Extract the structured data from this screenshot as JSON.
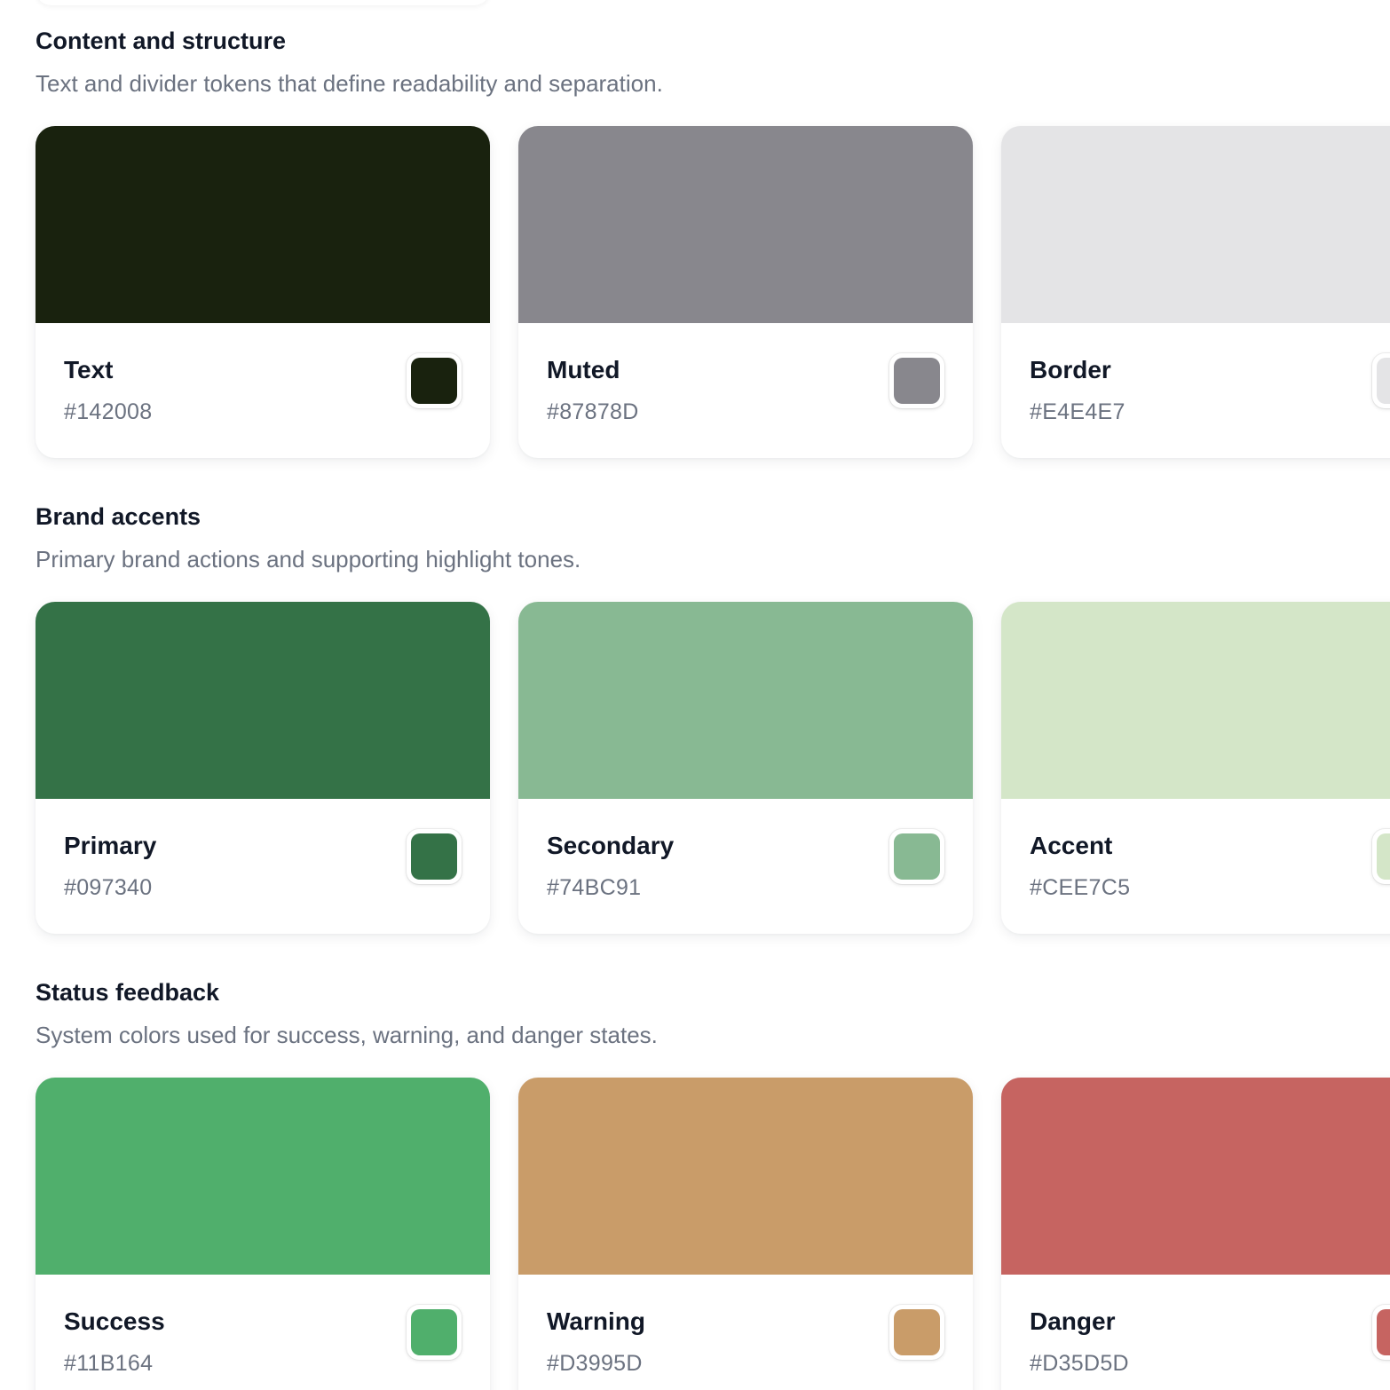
{
  "sections": [
    {
      "title": "Content and structure",
      "description": "Text and divider tokens that define readability and separation.",
      "tokens": [
        {
          "name": "Text",
          "hex": "#142008",
          "swatch": "#19220e"
        },
        {
          "name": "Muted",
          "hex": "#87878D",
          "swatch": "#88878d"
        },
        {
          "name": "Border",
          "hex": "#E4E4E7",
          "swatch": "#e4e4e6"
        }
      ]
    },
    {
      "title": "Brand accents",
      "description": "Primary brand actions and supporting highlight tones.",
      "tokens": [
        {
          "name": "Primary",
          "hex": "#097340",
          "swatch": "#347247"
        },
        {
          "name": "Secondary",
          "hex": "#74BC91",
          "swatch": "#88b993"
        },
        {
          "name": "Accent",
          "hex": "#CEE7C5",
          "swatch": "#d4e6c8"
        }
      ]
    },
    {
      "title": "Status feedback",
      "description": "System colors used for success, warning, and danger states.",
      "tokens": [
        {
          "name": "Success",
          "hex": "#11B164",
          "swatch": "#50af6c"
        },
        {
          "name": "Warning",
          "hex": "#D3995D",
          "swatch": "#c99c69"
        },
        {
          "name": "Danger",
          "hex": "#D35D5D",
          "swatch": "#c66461"
        }
      ]
    }
  ]
}
